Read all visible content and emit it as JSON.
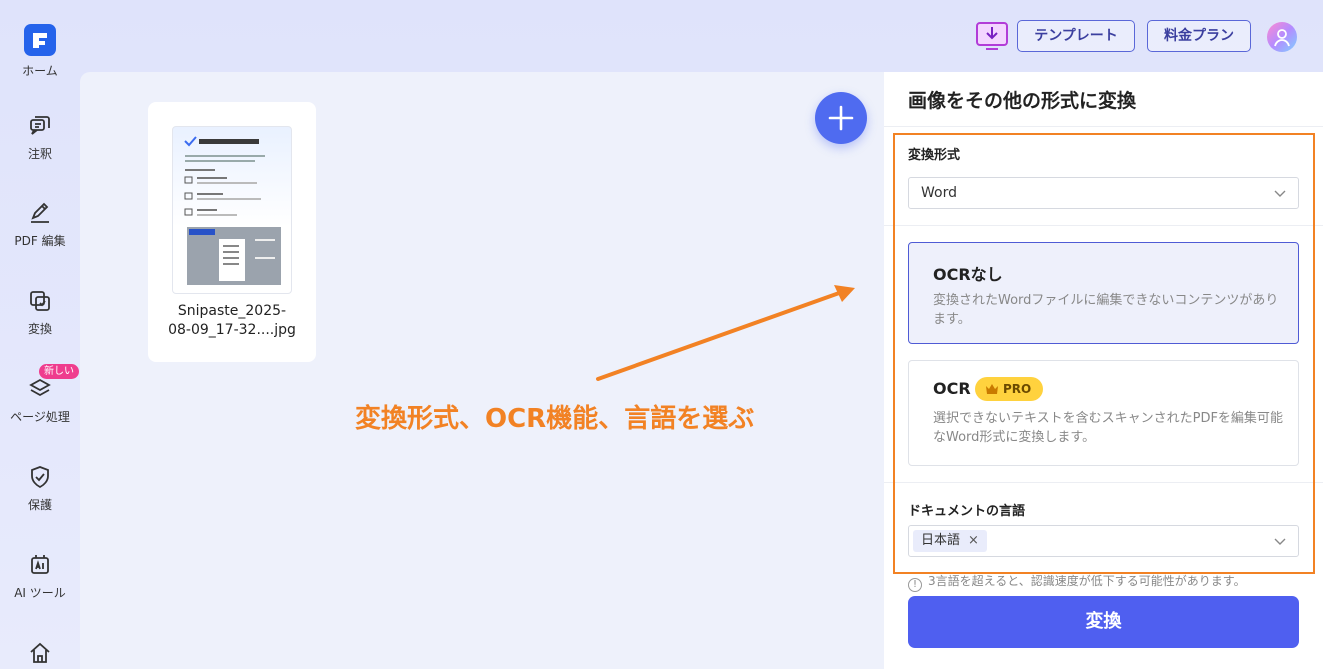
{
  "sidebar": {
    "items": [
      {
        "label": "ホーム",
        "icon": "home-logo-icon"
      },
      {
        "label": "注釈",
        "icon": "comment-icon"
      },
      {
        "label": "PDF 編集",
        "icon": "edit-pen-icon"
      },
      {
        "label": "変換",
        "icon": "convert-icon"
      },
      {
        "label": "ページ処理",
        "icon": "layers-icon",
        "badge": "新しい"
      },
      {
        "label": "保護",
        "icon": "shield-icon"
      },
      {
        "label": "AI ツール",
        "icon": "ai-tools-icon"
      },
      {
        "label": "",
        "icon": "house-icon"
      }
    ]
  },
  "topbar": {
    "template_label": "テンプレート",
    "pricing_label": "料金プラン"
  },
  "main": {
    "file": {
      "name_line1": "Snipaste_2025-",
      "name_line2": "08-09_17-32....jpg"
    },
    "annotation": "変換形式、OCR機能、言語を選ぶ"
  },
  "panel": {
    "title": "画像をその他の形式に変換",
    "format_label": "変換形式",
    "format_value": "Word",
    "options": [
      {
        "title": "OCRなし",
        "desc": "変換されたWordファイルに編集できないコンテンツがあります。",
        "selected": true
      },
      {
        "title": "OCR",
        "badge": "PRO",
        "desc": "選択できないテキストを含むスキャンされたPDFを編集可能なWord形式に変換します。",
        "selected": false
      }
    ],
    "language_label": "ドキュメントの言語",
    "language_tag": "日本語",
    "language_tag_remove": "×",
    "warning": "3言語を超えると、認識速度が低下する可能性があります。",
    "warning_icon": "!",
    "convert_label": "変換"
  },
  "colors": {
    "accent": "#4f5ff0",
    "annotation": "#f28224",
    "selected_bg": "#eef0fb"
  }
}
